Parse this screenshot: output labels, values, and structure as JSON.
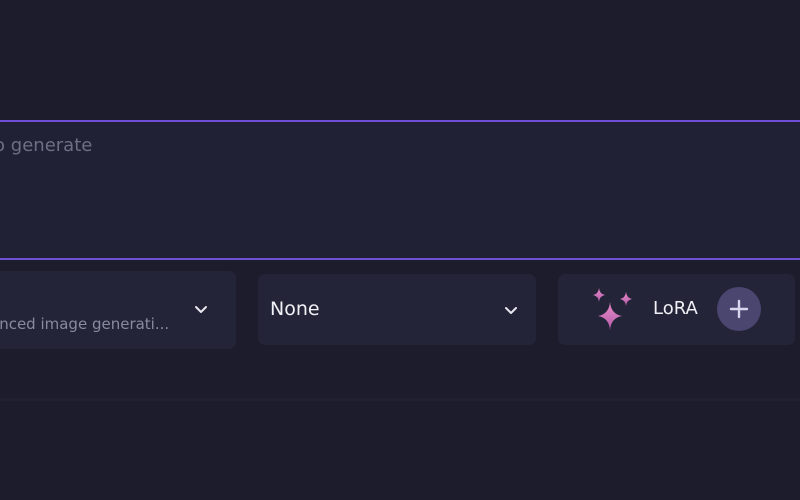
{
  "prompt": {
    "placeholder": "to generate",
    "value": ""
  },
  "model_select": {
    "subtitle": "anced image generati..."
  },
  "style_select": {
    "value": "None"
  },
  "lora": {
    "label": "LoRA"
  },
  "colors": {
    "background": "#1c1c2d",
    "prompt_border": "#6e4fd6",
    "panel": "#242438",
    "add_button": "#4a4670",
    "sparkle_accent": "#e07fbd"
  }
}
